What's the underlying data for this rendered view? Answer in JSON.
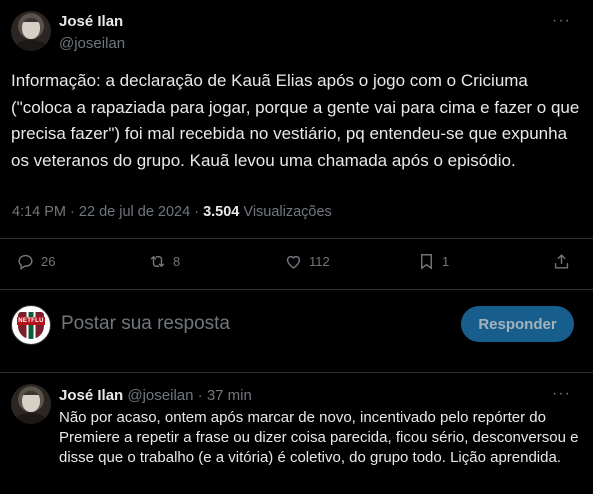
{
  "post": {
    "author_name": "José Ilan",
    "author_handle": "@joseilan",
    "more": "···",
    "text": "Informação: a declaração de Kauã Elias após o jogo com o Criciuma (\"coloca a rapaziada para jogar, porque a gente vai para cima e fazer o que precisa fazer\") foi mal recebida no vestiário, pq entendeu-se que expunha os veteranos do grupo. Kauã levou uma chamada após o episódio.",
    "time": "4:14 PM",
    "date": "22 de jul de 2024",
    "separator": "·",
    "views_count": "3.504",
    "views_label": "Visualizações"
  },
  "actions": {
    "replies": "26",
    "reposts": "8",
    "likes": "112",
    "bookmarks": "1"
  },
  "reply_box": {
    "placeholder": "Postar sua resposta",
    "button_label": "Responder",
    "avatar_text": "NETFLU"
  },
  "reply_post": {
    "author_name": "José Ilan",
    "author_handle": "@joseilan",
    "separator": "·",
    "time": "37 min",
    "more": "···",
    "text": "Não por acaso, ontem após marcar de novo, incentivado pelo repórter do Premiere a repetir a frase ou dizer coisa parecida, ficou sério, desconversou e disse que o trabalho (e a vitória) é coletivo, do grupo todo. Lição aprendida."
  },
  "icons": {
    "reply": "reply-icon",
    "repost": "repost-icon",
    "like": "heart-icon",
    "bookmark": "bookmark-icon",
    "share": "share-icon"
  },
  "colors": {
    "background": "#000000",
    "text": "#e7e9ea",
    "muted": "#71767b",
    "divider": "#2f3336",
    "button": "#1d6fa5"
  }
}
